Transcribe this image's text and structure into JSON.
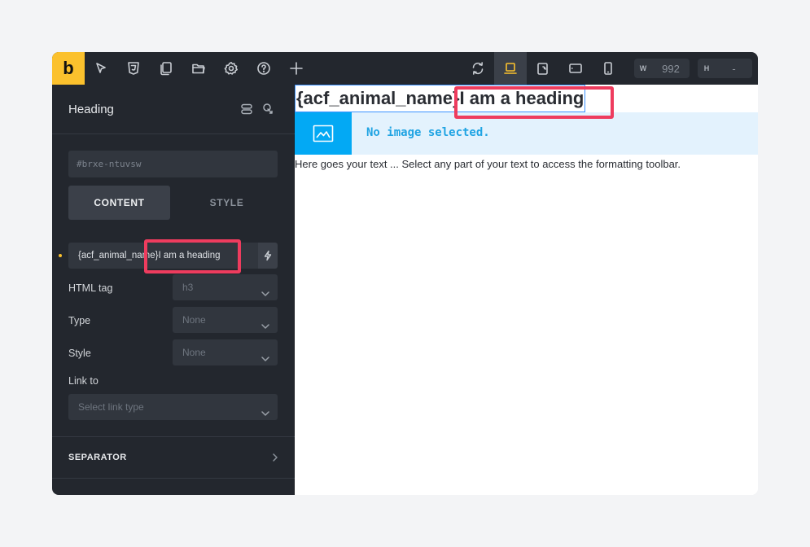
{
  "toolbar": {
    "logo": "b",
    "width_key": "W",
    "width_value": "992",
    "height_key": "H",
    "height_value": "-",
    "icons_left": [
      "pointer-icon",
      "css3-icon",
      "pages-icon",
      "folder-icon",
      "settings-icon",
      "help-icon",
      "add-icon"
    ],
    "icons_right": [
      "undo-redo-icon",
      "laptop-icon",
      "tablet-landscape-icon",
      "tablet-icon",
      "mobile-icon"
    ],
    "active_breakpoint": "laptop-icon"
  },
  "panel": {
    "title": "Heading",
    "element_id": "#brxe-ntuvsw",
    "tabs": [
      "CONTENT",
      "STYLE"
    ],
    "active_tab": "CONTENT",
    "text_value": "{acf_animal_name}I am a heading",
    "html_tag_label": "HTML tag",
    "html_tag_value": "h3",
    "type_label": "Type",
    "type_value": "None",
    "style_label": "Style",
    "style_value": "None",
    "link_label": "Link to",
    "link_placeholder": "Select link type",
    "section_separator": "SEPARATOR"
  },
  "canvas": {
    "heading": "{acf_animal_name}I am a heading",
    "image_placeholder": "No image selected.",
    "body_text": "Here goes your text ... Select any part of your text to access the formatting toolbar."
  },
  "colors": {
    "accent": "#fbc12d",
    "panel_bg": "#23272e",
    "highlight": "#ee3c5e",
    "image_block": "#03a9f4"
  }
}
